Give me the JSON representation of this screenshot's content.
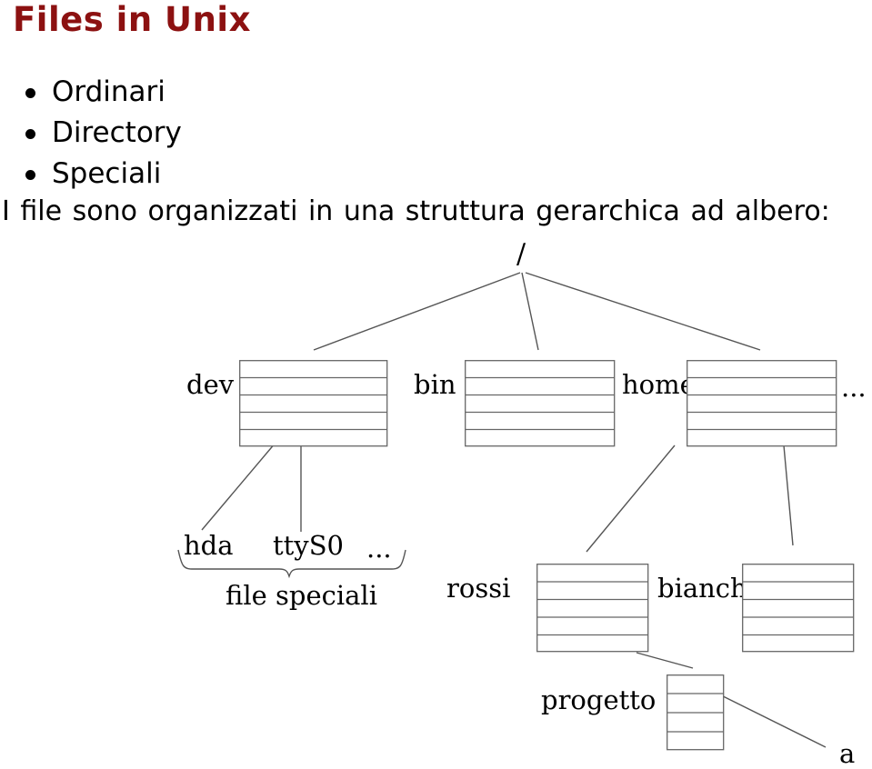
{
  "slide": {
    "title": "Files in Unix",
    "title_color": "#8c1111",
    "bullets": [
      {
        "label": "Ordinari"
      },
      {
        "label": "Directory"
      },
      {
        "label": "Speciali"
      }
    ],
    "paragraph": "I file sono organizzati in una struttura gerarchica ad albero:"
  },
  "tree": {
    "root": {
      "label": "/"
    },
    "level1": [
      {
        "label": "dev"
      },
      {
        "label": "bin"
      },
      {
        "label": "home"
      }
    ],
    "level1_more": "...",
    "level2_dev": [
      {
        "label": "hda"
      },
      {
        "label": "ttyS0"
      }
    ],
    "level2_dev_more": "...",
    "brace_label": "file speciali",
    "level2_home": [
      {
        "label": "rossi"
      },
      {
        "label": "bianchi"
      }
    ],
    "level3": [
      {
        "label": "progetto"
      }
    ],
    "level4": [
      {
        "label": "a"
      }
    ],
    "line_color": "#555555",
    "box_color": "#666666"
  }
}
